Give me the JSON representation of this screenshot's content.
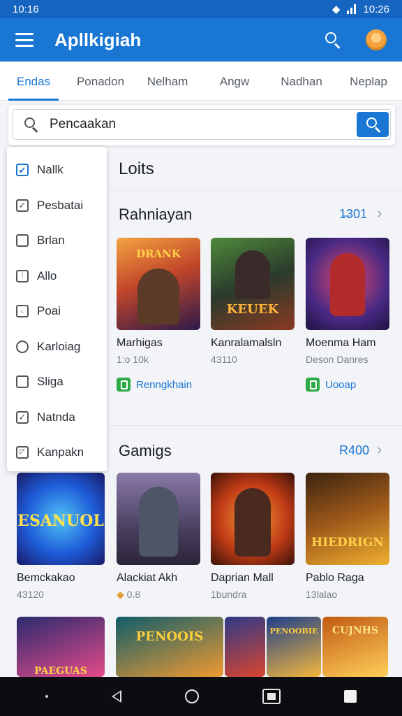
{
  "status": {
    "time_left": "10:16",
    "time_right": "10:26"
  },
  "appbar": {
    "title": "Apllkigiah",
    "search_icon": "search-icon",
    "avatar_icon": "avatar-icon"
  },
  "tabs": [
    "Endas",
    "Ponadon",
    "Nelham",
    "Angw",
    "Nadhan",
    "Neplap"
  ],
  "search": {
    "value": "Pencaakan",
    "placeholder": ""
  },
  "filter": {
    "items": [
      {
        "label": "Nallk",
        "checked": true,
        "shape": "checkbox"
      },
      {
        "label": "Pesbatai",
        "checked": true,
        "shape": "checkbox"
      },
      {
        "label": "Brlan",
        "checked": false,
        "shape": "checkbox"
      },
      {
        "label": "Allo",
        "checked": false,
        "shape": "checkbox"
      },
      {
        "label": "Poai",
        "checked": false,
        "shape": "checkbox"
      },
      {
        "label": "Karloiag",
        "checked": false,
        "shape": "radio"
      },
      {
        "label": "Sliga",
        "checked": false,
        "shape": "checkbox"
      },
      {
        "label": "Natnda",
        "checked": true,
        "shape": "checkbox"
      },
      {
        "label": "Kanpakn",
        "checked": false,
        "shape": "checkbox"
      }
    ]
  },
  "main": {
    "lists_title": "Loits",
    "sections": [
      {
        "title": "Rahniayan",
        "see_more": "1̶301",
        "cards": [
          {
            "name": "Marhigas",
            "sub": "1:o 10k",
            "action": "Renngkhain",
            "thumb_text": "DRANK",
            "colors": [
              "#f4a340",
              "#7a2e1e"
            ]
          },
          {
            "name": "Kanralamalsln",
            "sub": "43110",
            "action": "",
            "thumb_text": "KEUEK",
            "colors": [
              "#3d6b2c",
              "#b6522b"
            ]
          },
          {
            "name": "Moenma Ham",
            "sub": "Deson Danres",
            "action": "Uooap",
            "thumb_text": "",
            "colors": [
              "#4a2a84",
              "#d0323f"
            ]
          }
        ]
      },
      {
        "title": "Gamigs",
        "see_more": "R400",
        "cards": [
          {
            "name": "Bemckakao",
            "sub": "43120",
            "action": "",
            "thumb_text": "ESANUOL",
            "colors": [
              "#1e88e5",
              "#7b2ff7"
            ]
          },
          {
            "name": "Alackiat Akh",
            "sub": "0.8",
            "action": "",
            "thumb_text": "",
            "colors": [
              "#5a4b78",
              "#b0a6c8"
            ]
          },
          {
            "name": "Daprian Mall",
            "sub": "1bundra",
            "action": "",
            "thumb_text": "",
            "colors": [
              "#c23b16",
              "#f29c2c"
            ]
          },
          {
            "name": "Pablo Raga",
            "sub": "13lalao",
            "action": "",
            "thumb_text": "HIEDRIGN",
            "colors": [
              "#6b3a12",
              "#f0b030"
            ]
          }
        ]
      }
    ],
    "bottom_row": [
      {
        "text": "PAEGUAS",
        "colors": [
          "#2a2a6e",
          "#e54b8a"
        ]
      },
      {
        "text": "PENOOIS",
        "colors": [
          "#0f5d6b",
          "#f09a30"
        ]
      },
      {
        "text": "",
        "colors": [
          "#2d3a8a",
          "#d9452e"
        ]
      },
      {
        "text": "PENOOBIE",
        "colors": [
          "#1d3f8a",
          "#f4b63d"
        ]
      },
      {
        "text": "CUJNHS",
        "colors": [
          "#c15a12",
          "#ffcf5a"
        ]
      }
    ]
  },
  "navbar": {
    "icons": [
      "dot-icon",
      "back-icon",
      "home-icon",
      "apps-icon",
      "square-icon"
    ]
  },
  "colors": {
    "primary": "#1976d2",
    "status": "#1565c0",
    "accent_green": "#2eaa48"
  }
}
